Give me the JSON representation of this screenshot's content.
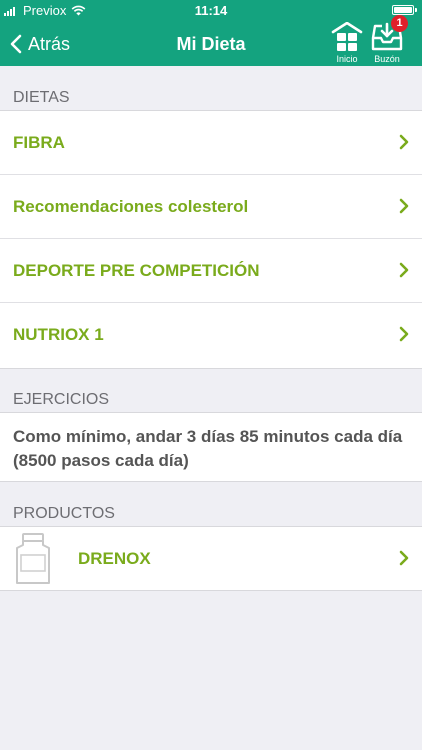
{
  "status_bar": {
    "carrier": "Previox",
    "time": "11:14"
  },
  "nav": {
    "back_label": "Atrás",
    "title": "Mi Dieta",
    "home_label": "Inicio",
    "inbox_label": "Buzón",
    "inbox_badge": "1"
  },
  "sections": {
    "dietas": {
      "header": "DIETAS",
      "items": [
        {
          "label": "FIBRA"
        },
        {
          "label": "Recomendaciones colesterol"
        },
        {
          "label": "DEPORTE PRE COMPETICIÓN"
        },
        {
          "label": "NUTRIOX 1"
        }
      ]
    },
    "ejercicios": {
      "header": "EJERCICIOS",
      "text": "Como mínimo, andar 3 días 85 minutos cada día (8500 pasos cada día)"
    },
    "productos": {
      "header": "PRODUCTOS",
      "items": [
        {
          "label": "DRENOX",
          "icon": "bottle-icon"
        }
      ]
    }
  },
  "colors": {
    "header_bg": "#14a37f",
    "accent_green": "#7aab1c",
    "page_bg": "#efeff4",
    "badge_red": "#e0202a"
  }
}
